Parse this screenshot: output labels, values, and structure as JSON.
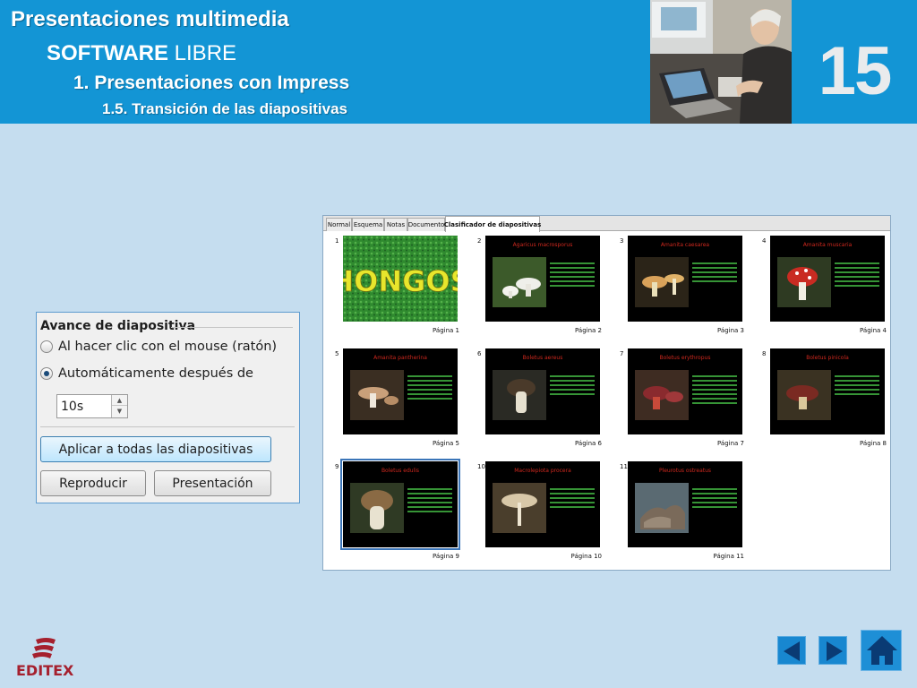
{
  "header": {
    "title": "Presentaciones multimedia",
    "subtitle_bold": "SOFTWARE",
    "subtitle_rest": " LIBRE",
    "section": "1.  Presentaciones con Impress",
    "subsection": "1.5. Transición de las diapositivas",
    "slide_number": "15",
    "accent_color": "#1395d5"
  },
  "panel": {
    "title": "Avance de diapositiva",
    "option_click": "Al hacer clic con el mouse (ratón)",
    "option_auto": "Automáticamente después de",
    "selected_option": "auto",
    "delay_value": "10s",
    "apply_all_button": "Aplicar a todas las diapositivas",
    "play_button": "Reproducir",
    "slideshow_button": "Presentación"
  },
  "sorter": {
    "tabs": [
      "Normal",
      "Esquema",
      "Notas",
      "Documento",
      "Clasificador de diapositivas"
    ],
    "active_tab": "Clasificador de diapositivas",
    "slides": [
      {
        "num": "1",
        "title": "HONGOS",
        "page": "Página 1"
      },
      {
        "num": "2",
        "title": "Agaricus macrosporus",
        "page": "Página 2"
      },
      {
        "num": "3",
        "title": "Amanita caesarea",
        "page": "Página 3"
      },
      {
        "num": "4",
        "title": "Amanita muscaria",
        "page": "Página 4"
      },
      {
        "num": "5",
        "title": "Amanita pantherina",
        "page": "Página 5"
      },
      {
        "num": "6",
        "title": "Boletus aereus",
        "page": "Página 6"
      },
      {
        "num": "7",
        "title": "Boletus erythropus",
        "page": "Página 7"
      },
      {
        "num": "8",
        "title": "Boletus pinicola",
        "page": "Página 8"
      },
      {
        "num": "9",
        "title": "Boletus edulis",
        "page": "Página 9"
      },
      {
        "num": "10",
        "title": "Macrolepiota procera",
        "page": "Página 10"
      },
      {
        "num": "11",
        "title": "Pleurotus ostreatus",
        "page": "Página 11"
      }
    ],
    "selected_slide": "9"
  },
  "footer": {
    "logo_text": "EDITEX",
    "prev_icon": "left-triangle",
    "next_icon": "right-triangle",
    "home_icon": "house"
  }
}
